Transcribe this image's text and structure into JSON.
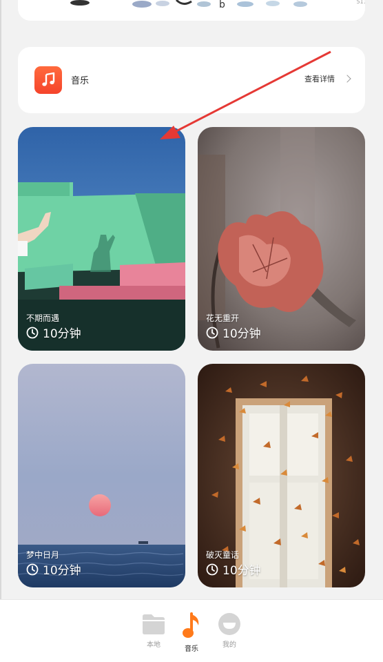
{
  "banner": {
    "corner_id": "511068"
  },
  "music_card": {
    "icon": "music-note-icon",
    "label": "音乐",
    "details_label": "查看详情",
    "accent": "#f5442b"
  },
  "tiles": [
    {
      "title": "不期而遇",
      "duration": "10分钟"
    },
    {
      "title": "花无重开",
      "duration": "10分钟"
    },
    {
      "title": "梦中日月",
      "duration": "10分钟"
    },
    {
      "title": "破灭童话",
      "duration": "10分钟"
    }
  ],
  "bottom_nav": {
    "items": [
      {
        "label": "本地",
        "icon": "folder-icon",
        "active": false
      },
      {
        "label": "音乐",
        "icon": "music-note-icon",
        "active": true
      },
      {
        "label": "我的",
        "icon": "profile-icon",
        "active": false
      }
    ],
    "active_color": "#ff7a1a"
  },
  "annotation": {
    "color": "#e53935"
  }
}
